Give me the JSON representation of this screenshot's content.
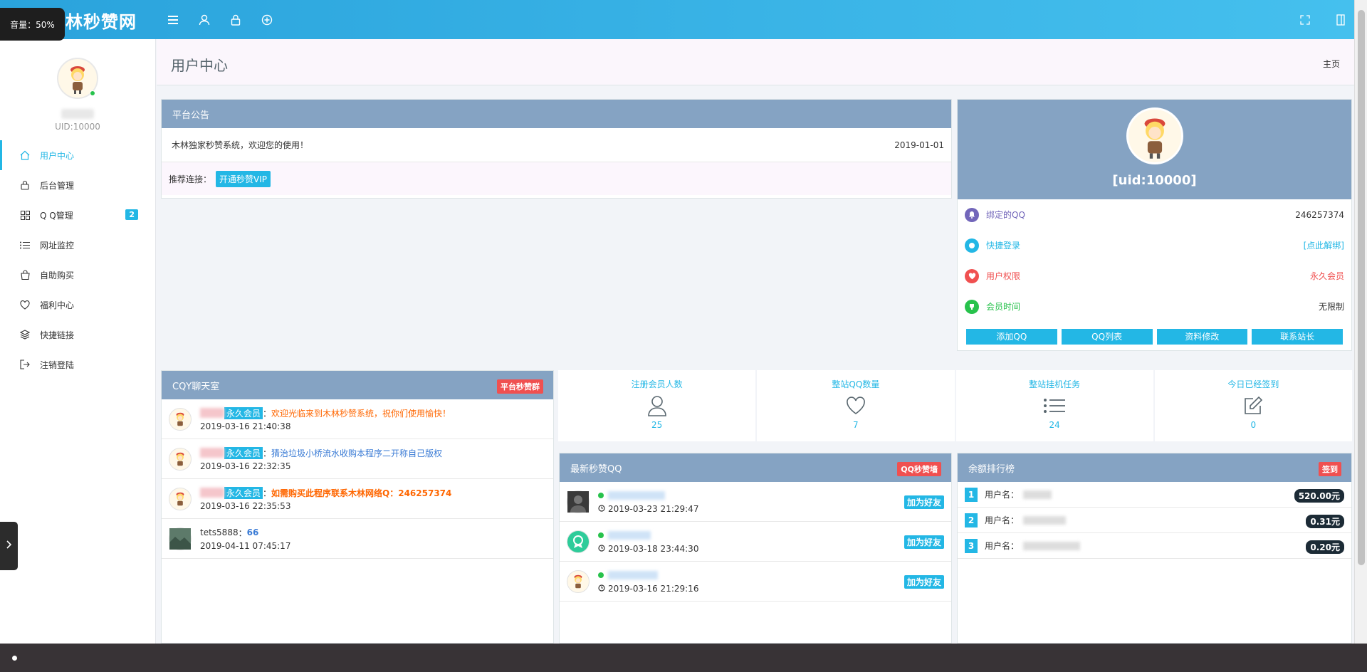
{
  "volume": {
    "label": "音量：50%"
  },
  "brand": {
    "name": "林秒赞网"
  },
  "page": {
    "title": "用户中心",
    "home_link": "主页"
  },
  "sidebar": {
    "uid": "UID:10000",
    "items": [
      {
        "label": "用户中心",
        "icon": "home-icon"
      },
      {
        "label": "后台管理",
        "icon": "lock-icon"
      },
      {
        "label": "Q Q管理",
        "icon": "grid-icon",
        "badge": "2"
      },
      {
        "label": "网址监控",
        "icon": "list-icon"
      },
      {
        "label": "自助购买",
        "icon": "bag-icon"
      },
      {
        "label": "福利中心",
        "icon": "heart-icon"
      },
      {
        "label": "快捷链接",
        "icon": "layers-icon"
      },
      {
        "label": "注销登陆",
        "icon": "logout-icon"
      }
    ]
  },
  "announcement": {
    "title": "平台公告",
    "text": "木林独家秒赞系统，欢迎您的使用！",
    "date": "2019-01-01",
    "recommend_label": "推荐连接：",
    "recommend_button": "开通秒赞VIP"
  },
  "user_card": {
    "uid": "[uid:10000]",
    "rows": [
      {
        "label": "绑定的QQ",
        "value": "246257374",
        "icon": "bell-icon",
        "color": "#7266ba"
      },
      {
        "label": "快捷登录",
        "value": "[点此解绑]",
        "icon": "chat-icon",
        "color": "#23b7e5"
      },
      {
        "label": "用户权限",
        "value": "永久会员",
        "icon": "heart-icon",
        "color": "#f05050"
      },
      {
        "label": "会员时间",
        "value": "无限制",
        "icon": "trophy-icon",
        "color": "#27c24c"
      }
    ],
    "buttons": [
      "添加QQ",
      "QQ列表",
      "资料修改",
      "联系站长"
    ]
  },
  "chat": {
    "title": "CQY聊天室",
    "tag": "平台秒赞群",
    "messages": [
      {
        "badge": "永久会员",
        "text": "欢迎光临来到木林秒赞系统，祝你们使用愉快！",
        "time": "2019-03-16 21:40:38",
        "style": "orange"
      },
      {
        "badge": "永久会员",
        "text": "猜治垃圾小桥流水收购本程序二开称自己版权",
        "time": "2019-03-16 22:32:35",
        "style": "blue"
      },
      {
        "badge": "永久会员",
        "text": "如需购买此程序联系木林网络Q：246257374",
        "time": "2019-03-16 22:35:53",
        "style": "orange"
      },
      {
        "user": "tets5888",
        "text": "66",
        "time": "2019-04-11 07:45:17",
        "style": "plain"
      }
    ]
  },
  "stats": [
    {
      "label": "注册会员人数",
      "value": "25",
      "icon": "user-icon"
    },
    {
      "label": "整站QQ数量",
      "value": "7",
      "icon": "heart-outline-icon"
    },
    {
      "label": "整站挂机任务",
      "value": "24",
      "icon": "list-icon"
    },
    {
      "label": "今日已经签到",
      "value": "0",
      "icon": "edit-icon"
    }
  ],
  "newest_qq": {
    "title": "最新秒赞QQ",
    "tag": "QQ秒赞墙",
    "items": [
      {
        "time": "2019-03-23 21:29:47",
        "button": "加为好友"
      },
      {
        "time": "2019-03-18 23:44:30",
        "button": "加为好友"
      },
      {
        "time": "2019-03-16 21:29:16",
        "button": "加为好友"
      }
    ]
  },
  "ranking": {
    "title": "余额排行榜",
    "tag": "签到",
    "items": [
      {
        "rank": "1",
        "name": "用户名：",
        "amount": "520.00元"
      },
      {
        "rank": "2",
        "name": "用户名：",
        "amount": "0.31元"
      },
      {
        "rank": "3",
        "name": "用户名：",
        "amount": "0.20元"
      }
    ]
  }
}
